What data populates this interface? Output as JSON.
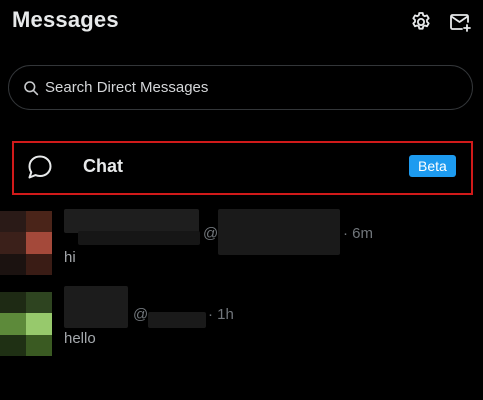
{
  "header": {
    "title": "Messages",
    "settings_icon": "gear-icon",
    "compose_icon": "new-message-icon"
  },
  "search": {
    "icon": "search-icon",
    "placeholder": "Search Direct Messages"
  },
  "chat_entry": {
    "icon": "chat-bubble-icon",
    "label": "Chat",
    "badge": "Beta",
    "badge_color": "#1d9bf0",
    "highlight_color": "#d11a1a"
  },
  "conversations": [
    {
      "handle_prefix": "@",
      "time": "· 6m",
      "last_message": "hi"
    },
    {
      "handle_prefix": "@",
      "time": "· 1h",
      "last_message": "hello"
    }
  ],
  "colors": {
    "background": "#000000",
    "text_primary": "#e7e9ea",
    "text_secondary": "#71767b",
    "border": "#333639"
  }
}
